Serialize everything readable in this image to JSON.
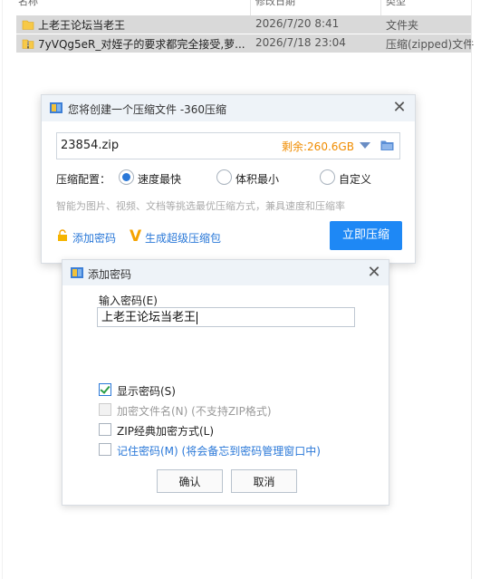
{
  "explorer": {
    "columns": {
      "name": "名称",
      "date": "修改日期",
      "type": "类型"
    },
    "rows": [
      {
        "name": "上老王论坛当老王",
        "date": "2026/7/20 8:41",
        "type": "文件夹",
        "icon": "folder-icon"
      },
      {
        "name": "7yVQg5eR_对姪子的要求都完全接受,萝...",
        "date": "2026/7/18 23:04",
        "type": "压缩(zipped)文件",
        "icon": "zip-icon"
      }
    ]
  },
  "compress_dialog": {
    "title": "您将创建一个压缩文件 -360压缩",
    "filename": "23854.zip",
    "free_space": "剩余:260.6GB",
    "config_label": "压缩配置：",
    "options": [
      "速度最快",
      "体积最小",
      "自定义"
    ],
    "selected_option": "速度最快",
    "hint": "智能为图片、视频、文档等挑选最优压缩方式，兼具速度和压缩率",
    "add_password": "添加密码",
    "super_package": "生成超级压缩包",
    "compress_button": "立即压缩"
  },
  "password_dialog": {
    "title": "添加密码",
    "input_label": "输入密码(E)",
    "password_value": "上老王论坛当老王",
    "checkboxes": [
      {
        "label": "显示密码(S)",
        "checked": true,
        "enabled": true
      },
      {
        "label": "加密文件名(N) (不支持ZIP格式)",
        "checked": false,
        "enabled": false
      },
      {
        "label": "ZIP经典加密方式(L)",
        "checked": false,
        "enabled": true
      },
      {
        "label": "记住密码(M) (将会备忘到密码管理窗口中)",
        "checked": false,
        "enabled": true
      }
    ],
    "ok_button": "确认",
    "cancel_button": "取消"
  },
  "colors": {
    "accent": "#1e88f5",
    "link": "#2a78d8",
    "warning": "#f08c00"
  }
}
